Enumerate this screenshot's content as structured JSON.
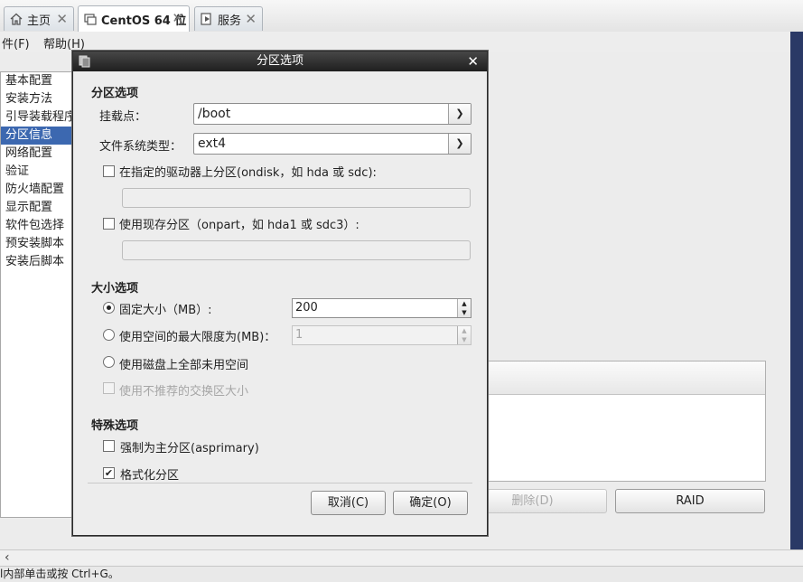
{
  "tabs": [
    {
      "label": "主页",
      "icon": "home-icon"
    },
    {
      "label": "CentOS 64 位",
      "icon": "vm-icon"
    },
    {
      "label": "服务",
      "icon": "services-icon"
    }
  ],
  "menu": {
    "file": "件(F)",
    "help": "帮助(H)"
  },
  "sidebar": {
    "items": [
      "基本配置",
      "安装方法",
      "引导装载程序",
      "分区信息",
      "网络配置",
      "验证",
      "防火墙配置",
      "显示配置",
      "软件包选择",
      "预安装脚本",
      "安装后脚本"
    ],
    "selected_index": 3
  },
  "background": {
    "delete_button": "删除(D)",
    "raid_button": "RAID"
  },
  "dialog": {
    "title": "分区选项",
    "section_partition": "分区选项",
    "mount_point_label": "挂载点：",
    "mount_point_value": "/boot",
    "fs_type_label": "文件系统类型：",
    "fs_type_value": "ext4",
    "ondisk_label": "在指定的驱动器上分区(ondisk，如 hda 或 sdc):",
    "ondisk_checked": false,
    "ondisk_value": "",
    "onpart_label": "使用现存分区（onpart，如 hda1 或 sdc3）:",
    "onpart_checked": false,
    "onpart_value": "",
    "section_size": "大小选项",
    "fixed_size_label": "固定大小（MB）:",
    "fixed_size_value": "200",
    "max_size_label": "使用空间的最大限度为(MB)：",
    "max_size_value": "1",
    "fill_disk_label": "使用磁盘上全部未用空间",
    "swap_label": "使用不推荐的交换区大小",
    "size_choice": "fixed",
    "section_special": "特殊选项",
    "primary_label": "强制为主分区(asprimary)",
    "primary_checked": false,
    "format_label": "格式化分区",
    "format_checked": true,
    "cancel_button": "取消(C)",
    "ok_button": "确定(O)"
  },
  "status": {
    "text": "l内部单击或按 Ctrl+G。"
  },
  "colors": {
    "selection": "#3c68b0",
    "title_bar": "#2b2b2b",
    "desktop_edge": "#2a3966"
  }
}
